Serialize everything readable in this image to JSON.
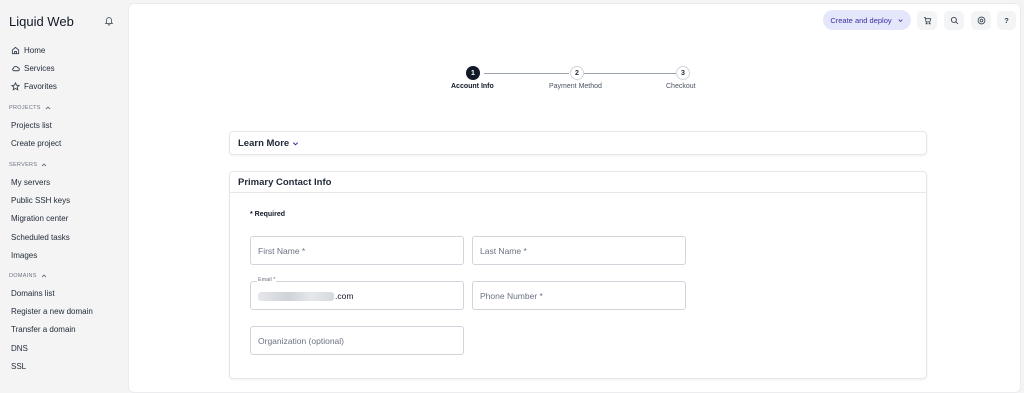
{
  "brand": "Liquid Web",
  "nav": {
    "home": "Home",
    "services": "Services",
    "favorites": "Favorites",
    "projects_section": "PROJECTS",
    "projects_list": "Projects list",
    "create_project": "Create project",
    "servers_section": "SERVERS",
    "my_servers": "My servers",
    "public_ssh_keys": "Public SSH keys",
    "migration_center": "Migration center",
    "scheduled_tasks": "Scheduled tasks",
    "images": "Images",
    "domains_section": "DOMAINS",
    "domains_list": "Domains list",
    "register_domain": "Register a new domain",
    "transfer_domain": "Transfer a domain",
    "dns": "DNS",
    "ssl": "SSL"
  },
  "topbar": {
    "deploy_label": "Create and deploy",
    "icons": [
      "cart-icon",
      "search-icon",
      "help-circle-icon",
      "question-icon"
    ],
    "question_label": "?"
  },
  "stepper": {
    "steps": [
      {
        "number": "1",
        "label": "Account Info",
        "state": "active"
      },
      {
        "number": "2",
        "label": "Payment Method",
        "state": "inactive"
      },
      {
        "number": "3",
        "label": "Checkout",
        "state": "inactive"
      }
    ]
  },
  "learn_more": {
    "title": "Learn More"
  },
  "contact": {
    "title": "Primary Contact Info",
    "required_note": "* Required",
    "first_name_placeholder": "First Name *",
    "last_name_placeholder": "Last Name *",
    "email_label": "Email *",
    "email_value_suffix": ".com",
    "phone_placeholder": "Phone Number *",
    "organization_placeholder": "Organization (optional)"
  },
  "colors": {
    "accent_bg": "#e4e6fb",
    "accent_text": "#3730a3",
    "active_step": "#111827"
  }
}
